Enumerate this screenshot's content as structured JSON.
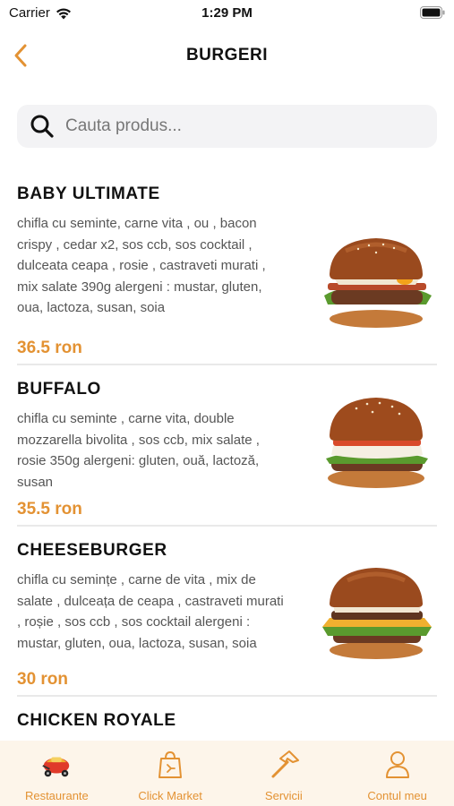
{
  "status_bar": {
    "carrier": "Carrier",
    "time": "1:29 PM"
  },
  "header": {
    "title": "BURGERI"
  },
  "search": {
    "placeholder": "Cauta produs..."
  },
  "products": [
    {
      "name": "BABY ULTIMATE",
      "description": "chifla cu seminte, carne vita , ou , bacon crispy , cedar x2, sos ccb, sos cocktail , dulceata ceapa , rosie , castraveti murati , mix salate 390g alergeni : mustar, gluten, oua, lactoza, susan, soia",
      "price": "36.5 ron"
    },
    {
      "name": "BUFFALO",
      "description": "chifla cu seminte , carne vita, double mozzarella bivolita , sos ccb, mix salate , rosie 350g alergeni: gluten, ouă, lactoză, susan",
      "price": "35.5 ron"
    },
    {
      "name": "CHEESEBURGER",
      "description": "chifla cu semințe , carne de vita , mix de salate , dulceața de ceapa , castraveti murati , roșie , sos ccb , sos cocktail alergeni : mustar, gluten, oua, lactoza, susan, soia",
      "price": "30 ron"
    },
    {
      "name": "CHICKEN ROYALE",
      "description": "",
      "price": ""
    }
  ],
  "tabbar": {
    "items": [
      {
        "label": "Restaurante",
        "icon": "scooter-icon"
      },
      {
        "label": "Click Market",
        "icon": "shopping-bag-icon"
      },
      {
        "label": "Servicii",
        "icon": "hammer-icon"
      },
      {
        "label": "Contul meu",
        "icon": "user-icon"
      }
    ]
  },
  "colors": {
    "accent": "#e39233",
    "tabbar_bg": "#fdf5ea",
    "search_bg": "#f3f3f5"
  }
}
